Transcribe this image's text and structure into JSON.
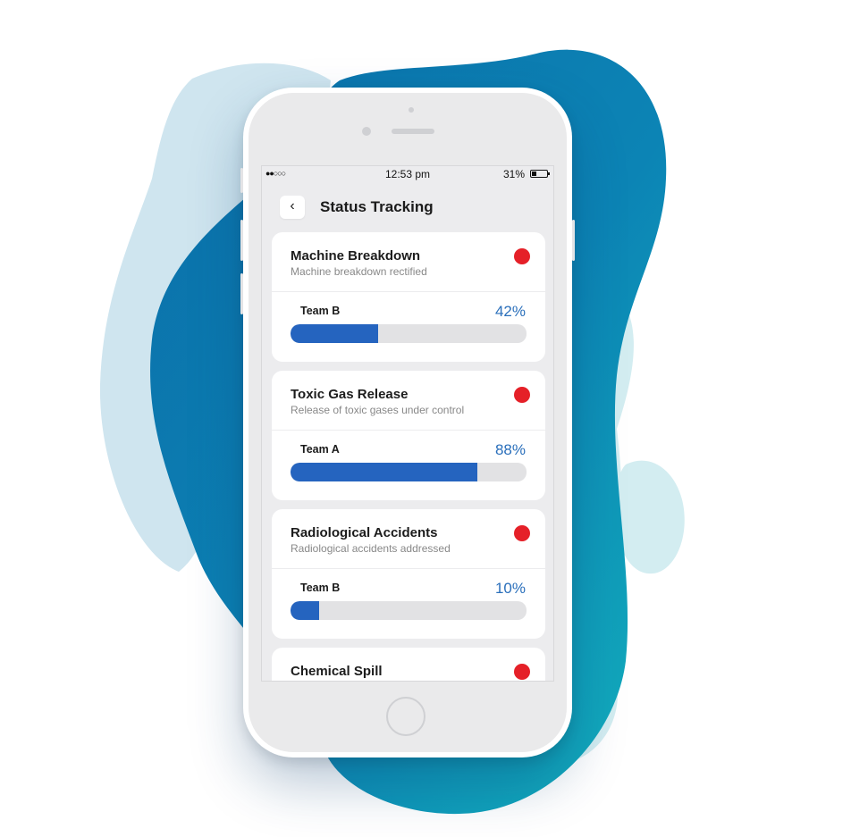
{
  "colors": {
    "accent": "#2564bf",
    "percent_text": "#2a6fbb",
    "alert_dot": "#e52028",
    "blob_dark": "#0b7ab3",
    "blob_light": "#cfe5ef"
  },
  "status_bar": {
    "signal": "●●○○○",
    "time": "12:53 pm",
    "battery": "31%",
    "battery_level": 0.31
  },
  "header": {
    "back_icon": "chevron-left-icon",
    "back_glyph": "‹",
    "title": "Status Tracking"
  },
  "incidents": [
    {
      "title": "Machine Breakdown",
      "subtitle": "Machine breakdown rectified",
      "team": "Team B",
      "percent_label": "42%",
      "progress": 0.37,
      "status_color": "#e52028"
    },
    {
      "title": "Toxic Gas Release",
      "subtitle": "Release of toxic gases under control",
      "team": "Team A",
      "percent_label": "88%",
      "progress": 0.79,
      "status_color": "#e52028"
    },
    {
      "title": "Radiological Accidents",
      "subtitle": "Radiological accidents addressed",
      "team": "Team B",
      "percent_label": "10%",
      "progress": 0.12,
      "status_color": "#e52028"
    },
    {
      "title": "Chemical Spill",
      "subtitle": "",
      "team": "",
      "percent_label": "",
      "progress": 0,
      "status_color": "#e52028"
    }
  ]
}
